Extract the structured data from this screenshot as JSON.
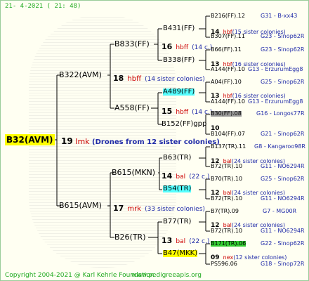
{
  "stamp": "21-   4-2021  (  21:  48)",
  "root": "B32(AVM)",
  "mid": {
    "num": "19",
    "label": "Imk",
    "desc": "(Drones from 12 sister colonies)"
  },
  "gen1": [
    {
      "name": "B322(AVM)",
      "num": "18",
      "label": "hbff",
      "desc": "(14 sister colonies)"
    },
    {
      "name": "B615(AVM)",
      "num": "17",
      "label": "mrk",
      "desc": "(33 sister colonies)"
    }
  ],
  "gen2": [
    {
      "name": "B833(FF)",
      "num": "16",
      "label": "hbff",
      "desc": "(14 c.)"
    },
    {
      "name": "A558(FF)",
      "num": "15",
      "label": "hbff",
      "desc": "(14 c.)"
    },
    {
      "name": "B615(MKN)",
      "num": "14",
      "label": "bal",
      "desc": "(22 c.)"
    },
    {
      "name": "B26(TR)",
      "num": "13",
      "label": "bal",
      "desc": "(22 c.)"
    }
  ],
  "gen3": [
    {
      "name": "B431(FF)",
      "num": "14",
      "label": "hbf",
      "desc": "(15 sister colonies)"
    },
    {
      "name": "B338(FF)",
      "num": "13",
      "label": "hbf",
      "desc": "(16 sister colonies)"
    },
    {
      "name": "A489(FF)",
      "num": "13",
      "label": "hbf",
      "desc": "(16 sister colonies)"
    },
    {
      "name": "B152(FF)gpp",
      "num": "10",
      "label": "",
      "desc": ""
    },
    {
      "name": "B63(TR)",
      "num": "12",
      "label": "bal",
      "desc": "(24 sister colonies)"
    },
    {
      "name": "B54(TR)",
      "num": "12",
      "label": "bal",
      "desc": "(24 sister colonies)"
    },
    {
      "name": "B77(TR)",
      "num": "12",
      "label": "bal",
      "desc": "(24 sister colonies)"
    },
    {
      "name": "B47(MKK)",
      "num": "09",
      "label": "nex",
      "desc": "(12 sister colonies)"
    }
  ],
  "gen4": [
    {
      "name": "B216(FF).12",
      "breed": "G31 - B-xx43"
    },
    {
      "name": "B307(FF).11",
      "breed": "G23 - Sinop62R"
    },
    {
      "name": "B66(FF).11",
      "breed": "G23 - Sinop62R"
    },
    {
      "name": "A144(FF).10",
      "breed": "G13 - ErzurumEgg8"
    },
    {
      "name": "A04(FF).10",
      "breed": "G25 - Sinop62R"
    },
    {
      "name": "A144(FF).10",
      "breed": "G13 - ErzurumEgg8"
    },
    {
      "name": "B30(FF).08",
      "breed": "G16 - Longos77R"
    },
    {
      "name": "B104(FF).07",
      "breed": "G21 - Sinop62R"
    },
    {
      "name": "B137(TR).11",
      "breed": "G8 - Kangaroo98R"
    },
    {
      "name": "B72(TR).10",
      "breed": "G11 - NO6294R"
    },
    {
      "name": "B70(TR).10",
      "breed": "G25 - Sinop62R"
    },
    {
      "name": "B72(TR).10",
      "breed": "G11 - NO6294R"
    },
    {
      "name": "B7(TR).09",
      "breed": "G7 - MG00R"
    },
    {
      "name": "B72(TR).10",
      "breed": "G11 - NO6294R"
    },
    {
      "name": "B171(TR).06",
      "breed": "G22 - Sinop62R"
    },
    {
      "name": "PS596.06",
      "breed": "G18 - Sinop72R"
    }
  ],
  "copyright": "Copyright 2004-2021 @ Karl Kehrle Foundation",
  "copyright_url": "www.pedigreeapis.org"
}
